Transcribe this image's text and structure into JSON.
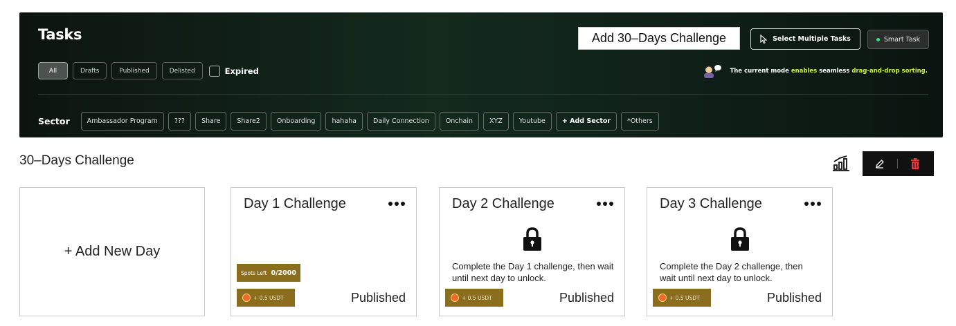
{
  "header": {
    "title": "Tasks",
    "add_challenge_label": "Add 30–Days Challenge",
    "select_multiple_label": "Select Multiple Tasks",
    "smart_task_label": "Smart Task",
    "filters": [
      "All",
      "Drafts",
      "Published",
      "Delisted"
    ],
    "expired_label": "Expired",
    "mode_note": {
      "prefix": "The current mode ",
      "highlight1": "enables",
      "middle": " seamless ",
      "highlight2": "drag-and-drop sorting."
    },
    "sector_label": "Sector",
    "sectors": [
      "Ambassador Program",
      "???",
      "Share",
      "Share2",
      "Onboarding",
      "hahaha",
      "Daily Connection",
      "Onchain",
      "XYZ",
      "Youtube"
    ],
    "add_sector_label": "+ Add Sector",
    "others_label": "*Others"
  },
  "section": {
    "title": "30–Days Challenge"
  },
  "add_day_label": "+ Add New Day",
  "days": [
    {
      "title": "Day 1 Challenge",
      "locked": false,
      "spots_label": "Spots Left",
      "spots_value": "0/2000",
      "reward": "+ 0.5 USDT",
      "status": "Published"
    },
    {
      "title": "Day 2 Challenge",
      "locked": true,
      "description": "Complete the Day 1 challenge, then wait until next day to unlock.",
      "reward": "+ 0.5 USDT",
      "status": "Published"
    },
    {
      "title": "Day 3 Challenge",
      "locked": true,
      "description": "Complete the Day 2 challenge, then wait until next day to unlock.",
      "reward": "+ 0.5 USDT",
      "status": "Published"
    }
  ],
  "colors": {
    "accent": "#c6f23b",
    "reward_bg": "#8a6d1d",
    "delete": "#e23b3b"
  }
}
